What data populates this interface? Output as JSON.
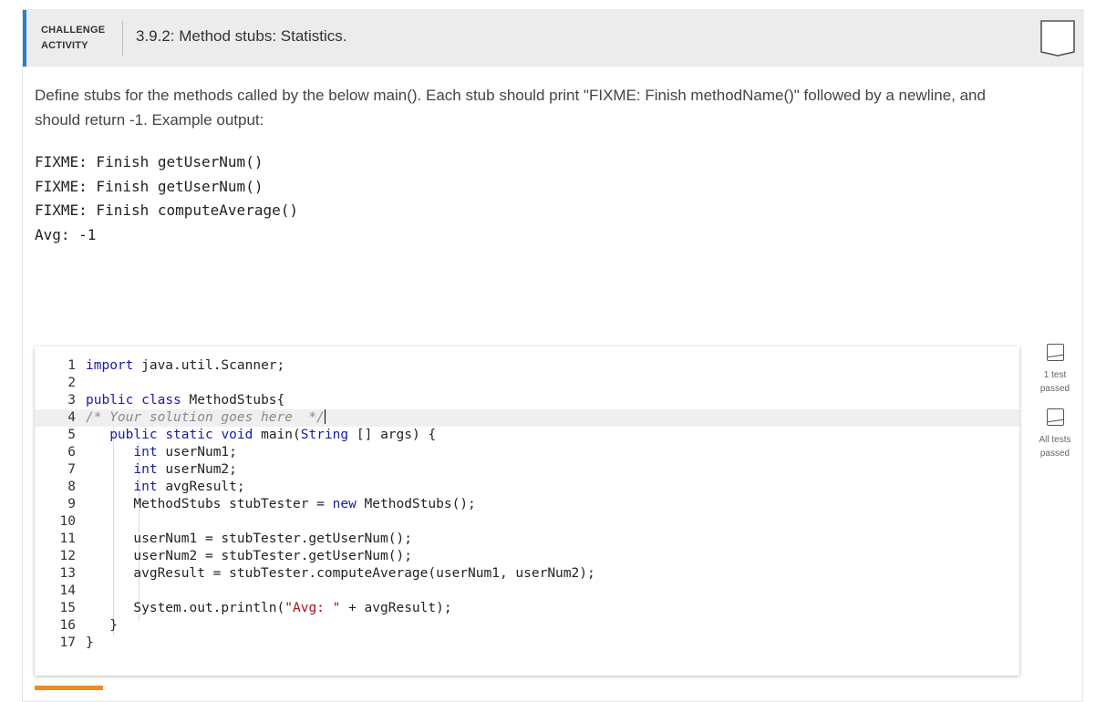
{
  "activity": {
    "label_line1": "CHALLENGE",
    "label_line2": "ACTIVITY",
    "title": "3.9.2: Method stubs: Statistics."
  },
  "instructions": "Define stubs for the methods called by the below main(). Each stub should print \"FIXME: Finish methodName()\" followed by a newline, and should return -1. Example output:",
  "example_output": [
    "FIXME: Finish getUserNum()",
    "FIXME: Finish getUserNum()",
    "FIXME: Finish computeAverage()",
    "Avg: -1"
  ],
  "editor": {
    "lines": [
      {
        "n": "1",
        "text": "import java.util.Scanner;"
      },
      {
        "n": "2",
        "text": ""
      },
      {
        "n": "3",
        "text": "public class MethodStubs{"
      },
      {
        "n": "4",
        "text": "/* Your solution goes here  */"
      },
      {
        "n": "5",
        "text": "   public static void main(String [] args) {"
      },
      {
        "n": "6",
        "text": "      int userNum1;"
      },
      {
        "n": "7",
        "text": "      int userNum2;"
      },
      {
        "n": "8",
        "text": "      int avgResult;"
      },
      {
        "n": "9",
        "text": "      MethodStubs stubTester = new MethodStubs();"
      },
      {
        "n": "10",
        "text": ""
      },
      {
        "n": "11",
        "text": "      userNum1 = stubTester.getUserNum();"
      },
      {
        "n": "12",
        "text": "      userNum2 = stubTester.getUserNum();"
      },
      {
        "n": "13",
        "text": "      avgResult = stubTester.computeAverage(userNum1, userNum2);"
      },
      {
        "n": "14",
        "text": ""
      },
      {
        "n": "15",
        "text": "      System.out.println(\"Avg: \" + avgResult);"
      },
      {
        "n": "16",
        "text": "   }"
      },
      {
        "n": "17",
        "text": "}"
      }
    ]
  },
  "tests": [
    {
      "line1": "1 test",
      "line2": "passed"
    },
    {
      "line1": "All tests",
      "line2": "passed"
    }
  ],
  "colors": {
    "accent": "#2a7fc4",
    "keyword": "#1a1aa6",
    "comment": "#8a8a8a",
    "string": "#a31515",
    "orange": "#f08a24"
  }
}
